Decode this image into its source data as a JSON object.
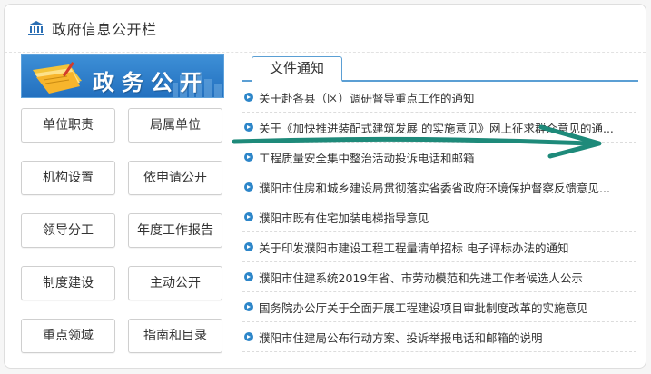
{
  "header": {
    "title": "政府信息公开栏",
    "icon": "government-building-icon"
  },
  "banner": {
    "text": "政务公开"
  },
  "buttons": [
    "单位职责",
    "局属单位",
    "机构设置",
    "依申请公开",
    "领导分工",
    "年度工作报告",
    "制度建设",
    "主动公开",
    "重点领域",
    "指南和目录"
  ],
  "tab": {
    "label": "文件通知"
  },
  "notices": [
    "关于赴各县（区）调研督导重点工作的通知",
    "关于《加快推进装配式建筑发展 的实施意见》网上征求群众意见的通...",
    "工程质量安全集中整治活动投诉电话和邮箱",
    "濮阳市住房和城乡建设局贯彻落实省委省政府环境保护督察反馈意见...",
    "濮阳市既有住宅加装电梯指导意见",
    "关于印发濮阳市建设工程工程量清单招标 电子评标办法的通知",
    "濮阳市住建系统2019年省、市劳动模范和先进工作者候选人公示",
    "国务院办公厅关于全面开展工程建设项目审批制度改革的实施意见",
    "濮阳市住建局公布行动方案、投诉举报电话和邮箱的说明"
  ],
  "colors": {
    "accent": "#2d86c9",
    "annotation_arrow": "#1e8a7a",
    "banner": "#2370bf"
  }
}
